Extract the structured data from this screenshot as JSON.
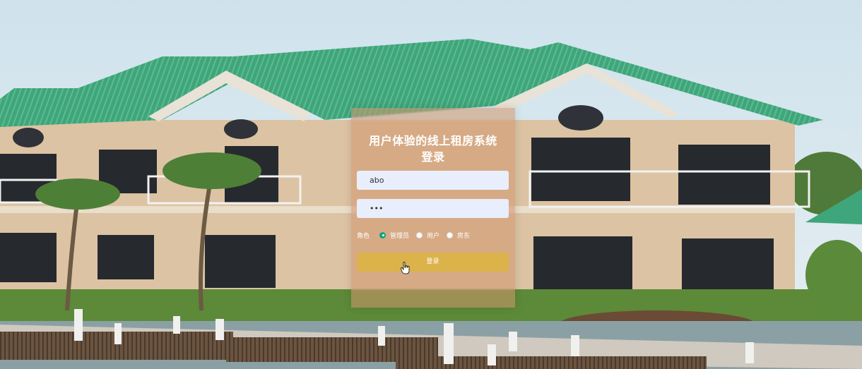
{
  "login": {
    "title_line1": "用户体验的线上租房系统",
    "title_line2": "登录",
    "username_value": "abo",
    "password_value": "•••",
    "role_label": "角色",
    "roles": [
      {
        "label": "管理员",
        "selected": true
      },
      {
        "label": "用户",
        "selected": false
      },
      {
        "label": "房东",
        "selected": false
      }
    ],
    "submit_label": "登录"
  },
  "colors": {
    "panel": "#d2966e",
    "field": "#e8eefb",
    "button": "#dcb24a",
    "radio_checked": "#10a37f"
  },
  "icons": {
    "cursor": "hand-pointer-icon"
  }
}
